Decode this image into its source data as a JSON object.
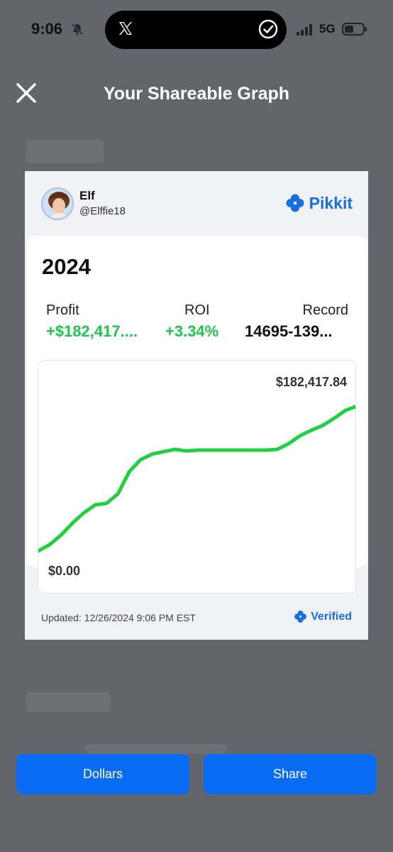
{
  "status_bar": {
    "time": "9:06",
    "network": "5G",
    "icons": [
      "bell-off-icon",
      "x-logo-icon",
      "check-circle-icon",
      "signal-icon",
      "battery-icon"
    ]
  },
  "header": {
    "title": "Your Shareable Graph",
    "close_icon": "close-icon"
  },
  "card": {
    "user": {
      "name": "Elf",
      "handle": "@Elffie18"
    },
    "brand": {
      "name": "Pikkit",
      "color": "#1a6fe0"
    },
    "year": "2024",
    "stats": {
      "profit": {
        "label": "Profit",
        "value": "+$182,417...."
      },
      "roi": {
        "label": "ROI",
        "value": "+3.34%"
      },
      "record": {
        "label": "Record",
        "value": "14695-139..."
      }
    },
    "graph": {
      "max_label": "$182,417.84",
      "min_label": "$0.00",
      "line_color": "#1fd13f"
    },
    "updated": "Updated: 12/26/2024 9:06 PM EST",
    "verified": "Verified"
  },
  "buttons": {
    "dollars": "Dollars",
    "share": "Share"
  },
  "chart_data": {
    "type": "line",
    "ylim": [
      0,
      182417.84
    ],
    "series": [
      {
        "values": [
          0,
          8000,
          20000,
          35000,
          48000,
          58000,
          60000,
          72000,
          100000,
          115000,
          122000,
          125000,
          128000,
          126000,
          127000,
          127000,
          127000,
          127000,
          127000,
          127000,
          127000,
          128000,
          135000,
          145000,
          152000,
          158000,
          167000,
          177000,
          182417.84
        ]
      }
    ]
  }
}
